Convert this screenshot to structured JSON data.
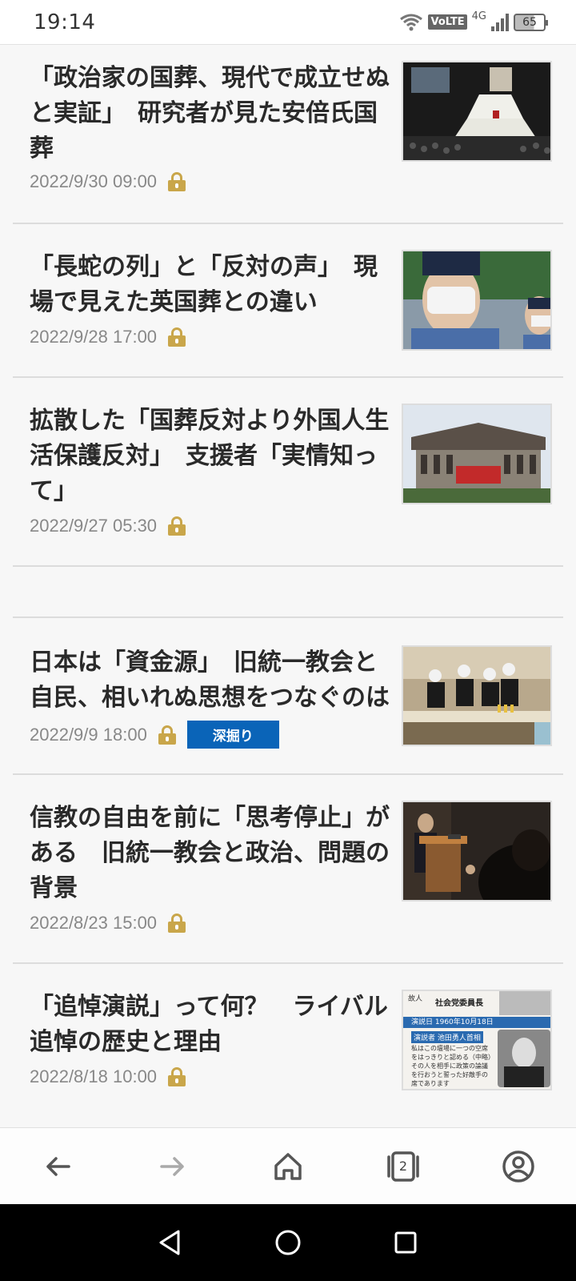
{
  "status_bar": {
    "time": "19:14",
    "volte": "VoLTE",
    "network": "4G",
    "battery": "65"
  },
  "articles": [
    {
      "title": "「政治家の国葬、現代で成立せぬと実証」　研究者が見た安倍氏国葬",
      "date": "2022/9/30 09:00",
      "locked": true
    },
    {
      "title": "「長蛇の列」と「反対の声」　現場で見えた英国葬との違い",
      "date": "2022/9/28 17:00",
      "locked": true
    },
    {
      "title": "拡散した「国葬反対より外国人生活保護反対」　支援者「実情知って」",
      "date": "2022/9/27 05:30",
      "locked": true
    },
    {
      "title": "日本は「資金源」　旧統一教会と自民、相いれぬ思想をつなぐのは",
      "date": "2022/9/9 18:00",
      "locked": true,
      "badge": "深掘り"
    },
    {
      "title": "信教の自由を前に「思考停止」がある　旧統一教会と政治、問題の背景",
      "date": "2022/8/23 15:00",
      "locked": true
    },
    {
      "title": "「追悼演説」って何？　ライバル追悼の歴史と理由",
      "date": "2022/8/18 10:00",
      "locked": true
    }
  ],
  "thumb6_text": {
    "top_label": "故人",
    "top_role": "社会党委員長",
    "date_label": "演説日 1960年10月18日",
    "speaker_label": "演説者 池田勇人首相",
    "quote": "私はこの壇場に一つの空席をはっきりと認める（中略）その人を相手に政策の論議を行おうと誓った好敵手の席であります"
  },
  "browser_bar": {
    "tab_count": "2"
  },
  "colors": {
    "accent_badge": "#0a64b8",
    "lock": "#c9a64a"
  }
}
